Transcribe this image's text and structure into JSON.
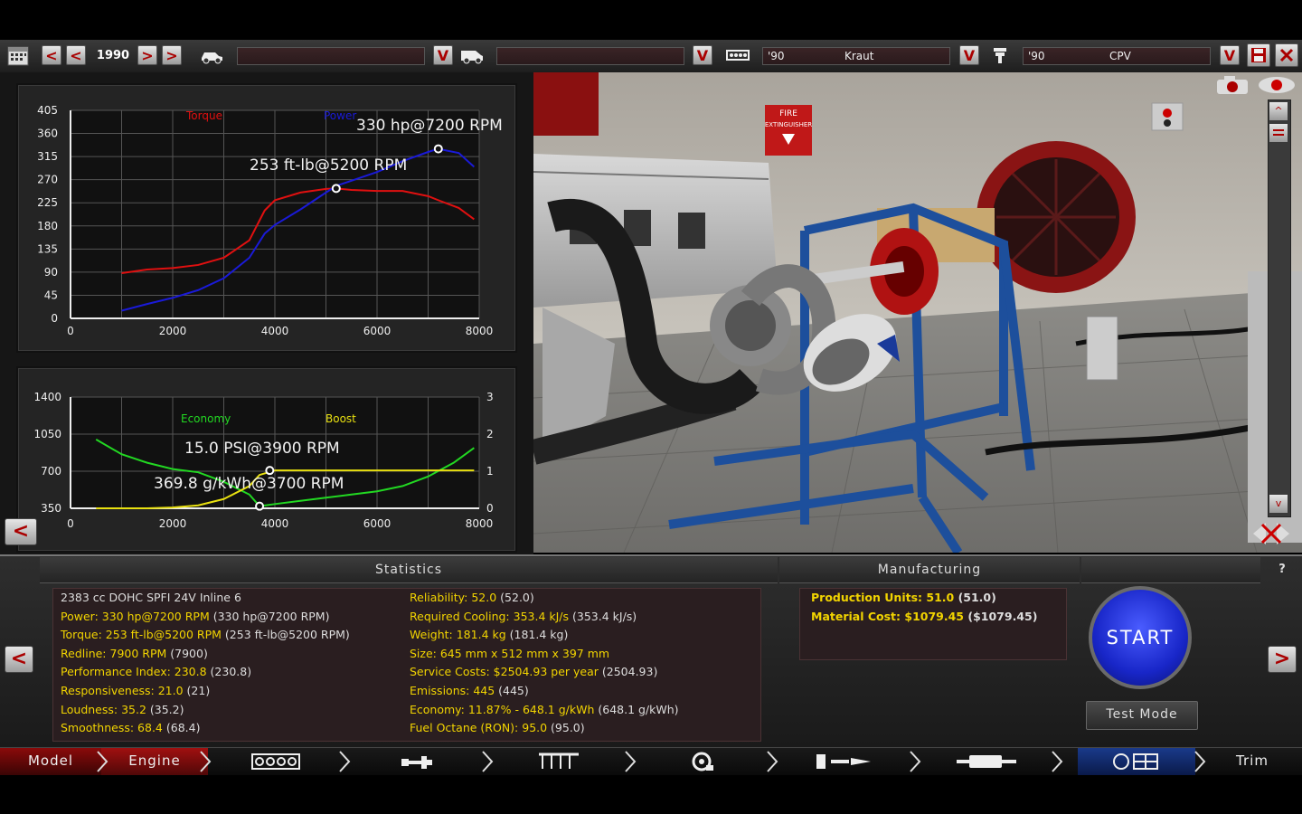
{
  "toolbar": {
    "year": "1990",
    "prev_fast": "<",
    "prev": "<",
    "next": ">",
    "next_fast": ">",
    "model_family_value": "",
    "model_trim_value": "",
    "engine_family_year": "'90",
    "engine_family_name": "Kraut",
    "engine_variant_year": "'90",
    "engine_variant_name": "CPV",
    "dropdown_glyph": "V",
    "icons": [
      "calendar-icon",
      "car-icon",
      "van-icon",
      "engine-block-icon",
      "piston-icon",
      "save-icon",
      "close-icon"
    ]
  },
  "viewport": {
    "sign_text_line1": "FIRE",
    "sign_text_line2": "EXTINGUISHER",
    "icons": [
      "camera-icon",
      "eye-icon",
      "scroll-up-icon",
      "scroll-down-icon",
      "view-toggle-icon"
    ]
  },
  "power_chart": {
    "y_ticks": [
      "405",
      "360",
      "315",
      "270",
      "225",
      "180",
      "135",
      "90",
      "45",
      "0"
    ],
    "x_ticks": [
      "0",
      "2000",
      "4000",
      "6000",
      "8000"
    ],
    "legend_torque": "Torque",
    "legend_power": "Power",
    "power_peak_label": "330 hp@7200 RPM",
    "torque_peak_label": "253 ft-lb@5200 RPM",
    "torque_color": "#e01010",
    "power_color": "#1a1ad8"
  },
  "economy_chart": {
    "y_ticks_left": [
      "1400",
      "1050",
      "700",
      "350"
    ],
    "y_ticks_right": [
      "3",
      "2",
      "1",
      "0"
    ],
    "x_ticks": [
      "0",
      "2000",
      "4000",
      "6000",
      "8000"
    ],
    "legend_economy": "Economy",
    "legend_boost": "Boost",
    "boost_peak_label": "15.0 PSI@3900 RPM",
    "economy_label": "369.8 g/kWh@3700 RPM",
    "economy_color": "#22d822",
    "boost_color": "#e8e010"
  },
  "chart_data": [
    {
      "type": "line",
      "x": [
        1000,
        1500,
        2000,
        2500,
        3000,
        3500,
        3800,
        4000,
        4500,
        5000,
        5200,
        5500,
        6000,
        6500,
        7000,
        7200,
        7600,
        7900
      ],
      "series": [
        {
          "name": "Torque",
          "values": [
            88,
            95,
            98,
            104,
            118,
            152,
            210,
            230,
            245,
            252,
            253,
            250,
            248,
            248,
            238,
            230,
            215,
            193
          ]
        },
        {
          "name": "Power",
          "values": [
            15,
            28,
            40,
            55,
            78,
            118,
            165,
            182,
            212,
            245,
            258,
            268,
            285,
            306,
            324,
            330,
            322,
            295
          ]
        }
      ],
      "xlim": [
        0,
        8000
      ],
      "ylim": [
        0,
        405
      ],
      "annotations": [
        "330 hp@7200 RPM",
        "253 ft-lb@5200 RPM"
      ]
    },
    {
      "type": "line",
      "x": [
        500,
        1000,
        1500,
        2000,
        2500,
        3000,
        3500,
        3700,
        4000,
        4500,
        5000,
        5500,
        6000,
        6500,
        7000,
        7500,
        7900
      ],
      "series": [
        {
          "name": "Economy",
          "values": [
            1000,
            860,
            780,
            720,
            690,
            600,
            480,
            370,
            390,
            420,
            450,
            480,
            510,
            560,
            650,
            780,
            920
          ]
        },
        {
          "name": "Boost",
          "values": [
            0,
            0,
            0,
            0.02,
            0.08,
            0.25,
            0.6,
            0.9,
            1.02,
            1.02,
            1.02,
            1.02,
            1.02,
            1.02,
            1.02,
            1.02,
            1.02
          ]
        }
      ],
      "xlim": [
        0,
        8000
      ],
      "ylim": [
        350,
        1400
      ],
      "y2lim": [
        0,
        3
      ],
      "annotations": [
        "15.0 PSI@3900 RPM",
        "369.8 g/kWh@3700 RPM"
      ]
    }
  ],
  "statistics": {
    "title": "Statistics",
    "left": [
      {
        "label": "2383 cc DOHC SPFI 24V Inline 6",
        "value": "",
        "color": "white"
      },
      {
        "label": "Power: 330 hp@7200 RPM",
        "value": " (330 hp@7200 RPM)"
      },
      {
        "label": "Torque: 253 ft-lb@5200 RPM",
        "value": " (253 ft-lb@5200 RPM)"
      },
      {
        "label": "Redline: 7900 RPM",
        "value": " (7900)"
      },
      {
        "label": "Performance Index: 230.8",
        "value": " (230.8)"
      },
      {
        "label": "Responsiveness: 21.0",
        "value": " (21)"
      },
      {
        "label": "Loudness: 35.2",
        "value": " (35.2)"
      },
      {
        "label": "Smoothness: 68.4",
        "value": " (68.4)"
      }
    ],
    "right": [
      {
        "label": "Reliability: 52.0",
        "value": " (52.0)"
      },
      {
        "label": "Required Cooling: 353.4 kJ/s",
        "value": " (353.4 kJ/s)"
      },
      {
        "label": "Weight: 181.4 kg",
        "value": " (181.4 kg)"
      },
      {
        "label": "Size: 645 mm x 512 mm x 397 mm",
        "value": ""
      },
      {
        "label": "Service Costs: $2504.93 per year",
        "value": " (2504.93)"
      },
      {
        "label": "Emissions: 445",
        "value": " (445)"
      },
      {
        "label": "Economy: 11.87% - 648.1 g/kWh",
        "value": " (648.1 g/kWh)"
      },
      {
        "label": "Fuel Octane (RON): 95.0",
        "value": " (95.0)"
      }
    ]
  },
  "manufacturing": {
    "title": "Manufacturing",
    "rows": [
      {
        "label": "Production Units: 51.0",
        "value": " (51.0)"
      },
      {
        "label": "Material Cost: $1079.45",
        "value": " ($1079.45)"
      }
    ]
  },
  "actions": {
    "start_label": "START",
    "test_mode_label": "Test Mode",
    "help_label": "?",
    "prev_label": "<",
    "next_label": ">",
    "chart_prev_label": "<"
  },
  "nav": {
    "model": "Model",
    "engine": "Engine",
    "trim": "Trim",
    "icons": [
      "block-icon",
      "crank-icon",
      "valvetrain-icon",
      "turbo-icon",
      "fuel-icon",
      "exhaust-icon",
      "test-icon"
    ]
  }
}
